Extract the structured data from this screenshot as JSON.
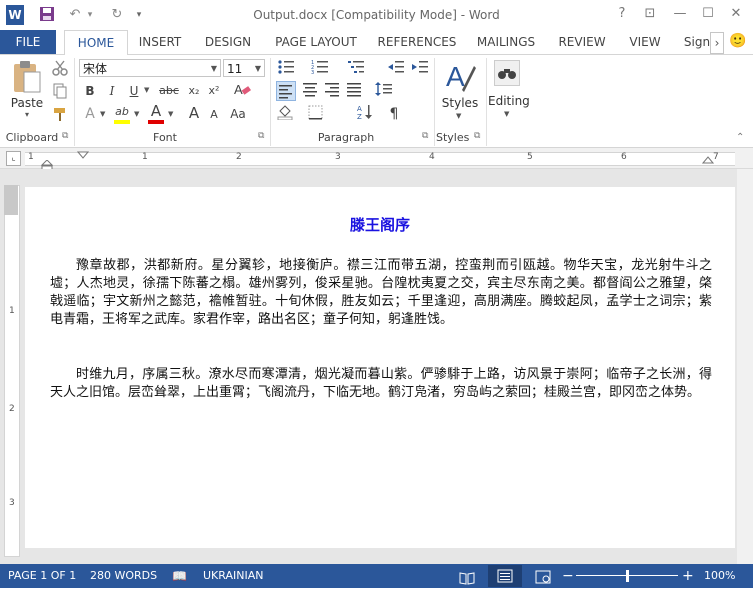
{
  "window": {
    "title": "Output.docx [Compatibility Mode] - Word",
    "help": "?",
    "ribbon_options": "⊡",
    "minimize": "—",
    "maximize": "☐",
    "close": "✕"
  },
  "quick_access": {
    "word_logo": "W",
    "save": "💾",
    "undo": "↶",
    "undo_arrow": "▾",
    "redo": "↻",
    "customize": "▾"
  },
  "tabs": [
    {
      "label": "FILE"
    },
    {
      "label": "HOME"
    },
    {
      "label": "INSERT"
    },
    {
      "label": "DESIGN"
    },
    {
      "label": "PAGE LAYOUT"
    },
    {
      "label": "REFERENCES"
    },
    {
      "label": "MAILINGS"
    },
    {
      "label": "REVIEW"
    },
    {
      "label": "VIEW"
    },
    {
      "label": "Sign"
    }
  ],
  "tab_scroll": "›",
  "smiley": "🙂",
  "ribbon": {
    "clipboard": {
      "label": "Clipboard",
      "paste": "Paste",
      "paste_arrow": "▾"
    },
    "font": {
      "label": "Font",
      "font_name": "宋体",
      "font_size": "11",
      "bold": "B",
      "italic": "I",
      "underline": "U",
      "strike": "abc",
      "subscript": "x₂",
      "superscript": "x²",
      "text_effects": "A",
      "highlight": "ab",
      "font_color": "A",
      "grow": "A",
      "shrink": "A",
      "change_case": "Aa",
      "highlight_color": "#ffff00",
      "font_color_value": "#e00000"
    },
    "paragraph": {
      "label": "Paragraph",
      "pilcrow": "¶"
    },
    "styles": {
      "label": "Styles",
      "button": "Styles"
    },
    "editing": {
      "button": "Editing"
    }
  },
  "ruler": {
    "marks": [
      "1",
      "2",
      "1",
      "2",
      "3",
      "4",
      "5",
      "6",
      "7"
    ]
  },
  "vruler": {
    "marks": [
      "1",
      "2",
      "3"
    ]
  },
  "document": {
    "title": "滕王阁序",
    "paragraphs": [
      "豫章故郡，洪都新府。星分翼轸，地接衡庐。襟三江而带五湖，控蛮荆而引瓯越。物华天宝，龙光射牛斗之墟；人杰地灵，徐孺下陈蕃之榻。雄州雾列，俊采星驰。台隍枕夷夏之交，宾主尽东南之美。都督阎公之雅望，棨戟遥临；宇文新州之懿范，襜帷暂驻。十旬休假，胜友如云；千里逢迎，高朋满座。腾蛟起凤，孟学士之词宗；紫电青霜，王将军之武库。家君作宰，路出名区；童子何知，躬逢胜饯。",
      "时维九月，序属三秋。潦水尽而寒潭清，烟光凝而暮山紫。俨骖騑于上路，访风景于崇阿；临帝子之长洲，得天人之旧馆。层峦耸翠，上出重霄；飞阁流丹，下临无地。鹤汀凫渚，穷岛屿之萦回；桂殿兰宫，即冈峦之体势。"
    ]
  },
  "status": {
    "page": "PAGE 1 OF 1",
    "words": "280 WORDS",
    "language": "UKRAINIAN",
    "zoom": "100%",
    "zoom_minus": "−",
    "zoom_plus": "+",
    "zoom_level_percent": 100,
    "color": "#2b579a"
  }
}
